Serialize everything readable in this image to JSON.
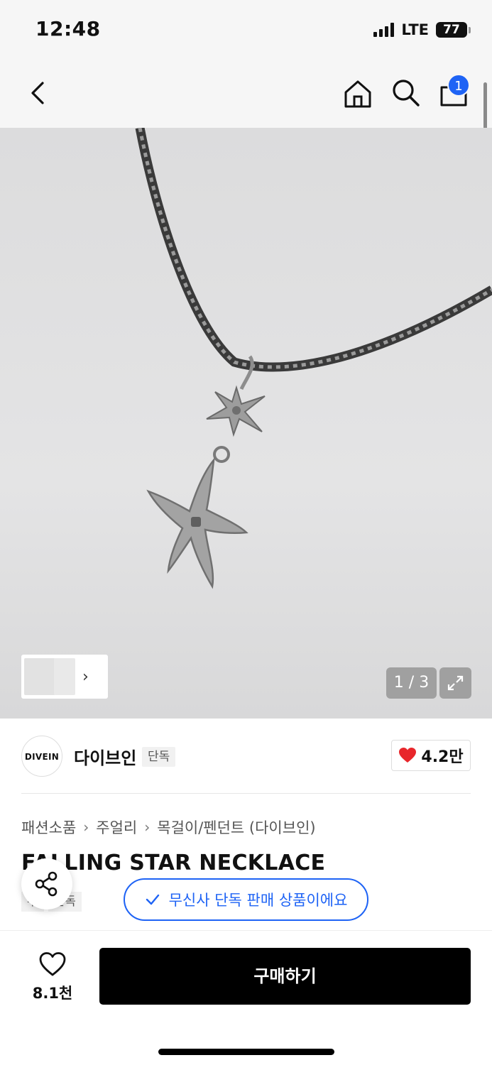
{
  "status_bar": {
    "time": "12:48",
    "network": "LTE",
    "battery": "77"
  },
  "nav": {
    "cart_count": "1"
  },
  "gallery": {
    "counter": "1 / 3"
  },
  "brand": {
    "logo_text": "DIVEIN",
    "name": "다이브인",
    "tag": "단독",
    "likes": "4.2만"
  },
  "breadcrumb": [
    "패션소품",
    "주얼리",
    "목걸이/펜던트 (다이브인)"
  ],
  "product": {
    "title": "FALLING STAR NECKLACE",
    "tags": [
      "무",
      "단독"
    ],
    "exclusive_notice": "무신사 단독 판매 상품이에요"
  },
  "bottom_bar": {
    "wish_count": "8.1천",
    "buy_label": "구매하기"
  },
  "colors": {
    "accent": "#1e63f5",
    "heart": "#e8262b",
    "buy_button": "#000000"
  }
}
